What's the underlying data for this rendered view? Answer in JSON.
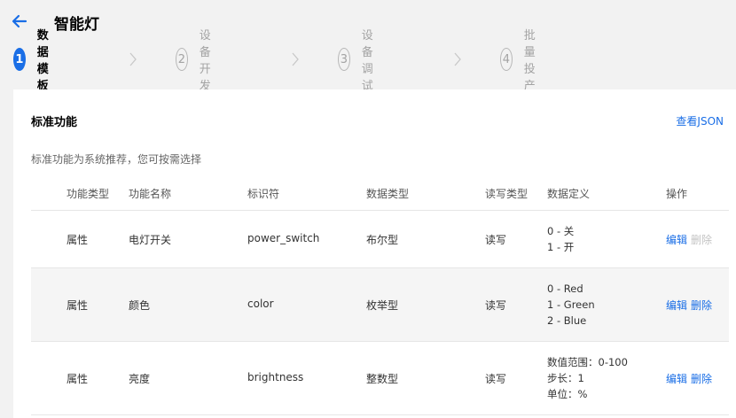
{
  "header": {
    "title": "智能灯",
    "back_icon": "arrow-left-icon"
  },
  "steps": [
    {
      "num": "1",
      "label": "数据模板",
      "active": true
    },
    {
      "num": "2",
      "label": "设备开发",
      "active": false
    },
    {
      "num": "3",
      "label": "设备调试",
      "active": false
    },
    {
      "num": "4",
      "label": "批量投产",
      "active": false
    }
  ],
  "card": {
    "title": "标准功能",
    "view_json": "查看JSON",
    "description": "标准功能为系统推荐，您可按需选择"
  },
  "table": {
    "columns": [
      "功能类型",
      "功能名称",
      "标识符",
      "数据类型",
      "读写类型",
      "数据定义",
      "操作"
    ],
    "rows": [
      {
        "type": "属性",
        "name": "电灯开关",
        "id": "power_switch",
        "dtype": "布尔型",
        "rw": "读写",
        "defs": [
          "0 - 关",
          "1 - 开"
        ],
        "edit": "编辑",
        "del": "删除",
        "del_disabled": true
      },
      {
        "type": "属性",
        "name": "颜色",
        "id": "color",
        "dtype": "枚举型",
        "rw": "读写",
        "defs": [
          "0 - Red",
          "1 - Green",
          "2 - Blue"
        ],
        "edit": "编辑",
        "del": "删除",
        "del_disabled": false
      },
      {
        "type": "属性",
        "name": "亮度",
        "id": "brightness",
        "dtype": "整数型",
        "rw": "读写",
        "defs": [
          "数值范围：0-100",
          "步长：1",
          "单位：%"
        ],
        "edit": "编辑",
        "del": "删除",
        "del_disabled": false
      }
    ]
  },
  "colors": {
    "accent": "#1a6ee6",
    "disabled": "#c3c3c3"
  }
}
